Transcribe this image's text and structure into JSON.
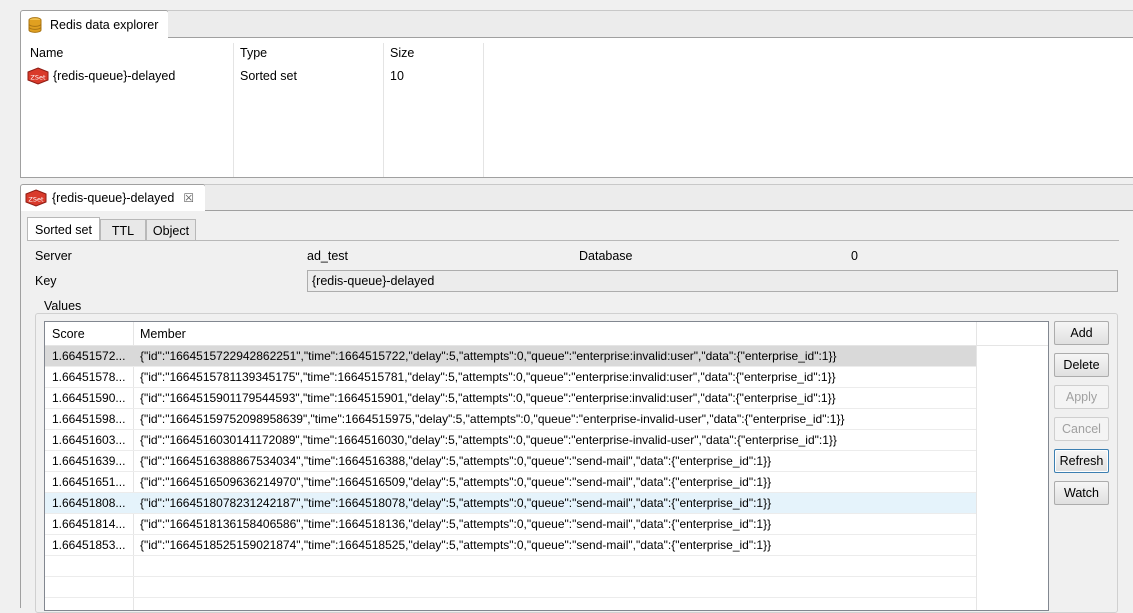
{
  "explorer": {
    "tab_title": "Redis data explorer",
    "columns": [
      "Name",
      "Type",
      "Size"
    ],
    "rows": [
      {
        "icon": "zset-icon",
        "name": "{redis-queue}-delayed",
        "type": "Sorted set",
        "size": "10"
      }
    ]
  },
  "editor": {
    "tab_title": "{redis-queue}-delayed",
    "close_glyph": "☒",
    "tabs": [
      "Sorted set",
      "TTL",
      "Object"
    ],
    "server_label": "Server",
    "server_value": "ad_test",
    "database_label": "Database",
    "database_value": "0",
    "key_label": "Key",
    "key_value": "{redis-queue}-delayed",
    "values_label": "Values",
    "table": {
      "columns": [
        "Score",
        "Member"
      ],
      "rows": [
        {
          "score": "1.66451572...",
          "member": "{\"id\":\"1664515722942862251\",\"time\":1664515722,\"delay\":5,\"attempts\":0,\"queue\":\"enterprise:invalid:user\",\"data\":{\"enterprise_id\":1}}"
        },
        {
          "score": "1.66451578...",
          "member": "{\"id\":\"1664515781139345175\",\"time\":1664515781,\"delay\":5,\"attempts\":0,\"queue\":\"enterprise:invalid:user\",\"data\":{\"enterprise_id\":1}}"
        },
        {
          "score": "1.66451590...",
          "member": "{\"id\":\"1664515901179544593\",\"time\":1664515901,\"delay\":5,\"attempts\":0,\"queue\":\"enterprise:invalid:user\",\"data\":{\"enterprise_id\":1}}"
        },
        {
          "score": "1.66451598...",
          "member": "{\"id\":\"16645159752098958639\",\"time\":1664515975,\"delay\":5,\"attempts\":0,\"queue\":\"enterprise-invalid-user\",\"data\":{\"enterprise_id\":1}}"
        },
        {
          "score": "1.66451603...",
          "member": "{\"id\":\"1664516030141172089\",\"time\":1664516030,\"delay\":5,\"attempts\":0,\"queue\":\"enterprise-invalid-user\",\"data\":{\"enterprise_id\":1}}"
        },
        {
          "score": "1.66451639...",
          "member": "{\"id\":\"1664516388867534034\",\"time\":1664516388,\"delay\":5,\"attempts\":0,\"queue\":\"send-mail\",\"data\":{\"enterprise_id\":1}}"
        },
        {
          "score": "1.66451651...",
          "member": "{\"id\":\"1664516509636214970\",\"time\":1664516509,\"delay\":5,\"attempts\":0,\"queue\":\"send-mail\",\"data\":{\"enterprise_id\":1}}"
        },
        {
          "score": "1.66451808...",
          "member": "{\"id\":\"1664518078231242187\",\"time\":1664518078,\"delay\":5,\"attempts\":0,\"queue\":\"send-mail\",\"data\":{\"enterprise_id\":1}}"
        },
        {
          "score": "1.66451814...",
          "member": "{\"id\":\"1664518136158406586\",\"time\":1664518136,\"delay\":5,\"attempts\":0,\"queue\":\"send-mail\",\"data\":{\"enterprise_id\":1}}"
        },
        {
          "score": "1.66451853...",
          "member": "{\"id\":\"1664518525159021874\",\"time\":1664518525,\"delay\":5,\"attempts\":0,\"queue\":\"send-mail\",\"data\":{\"enterprise_id\":1}}"
        }
      ]
    },
    "buttons": {
      "add": "Add",
      "delete": "Delete",
      "apply": "Apply",
      "cancel": "Cancel",
      "refresh": "Refresh",
      "watch": "Watch"
    }
  },
  "colors": {
    "selected_row": "#d9d9d9",
    "hover_row": "#e5f3fb",
    "zset_icon": "#d93a2b",
    "db_icon": "#e0a020"
  }
}
